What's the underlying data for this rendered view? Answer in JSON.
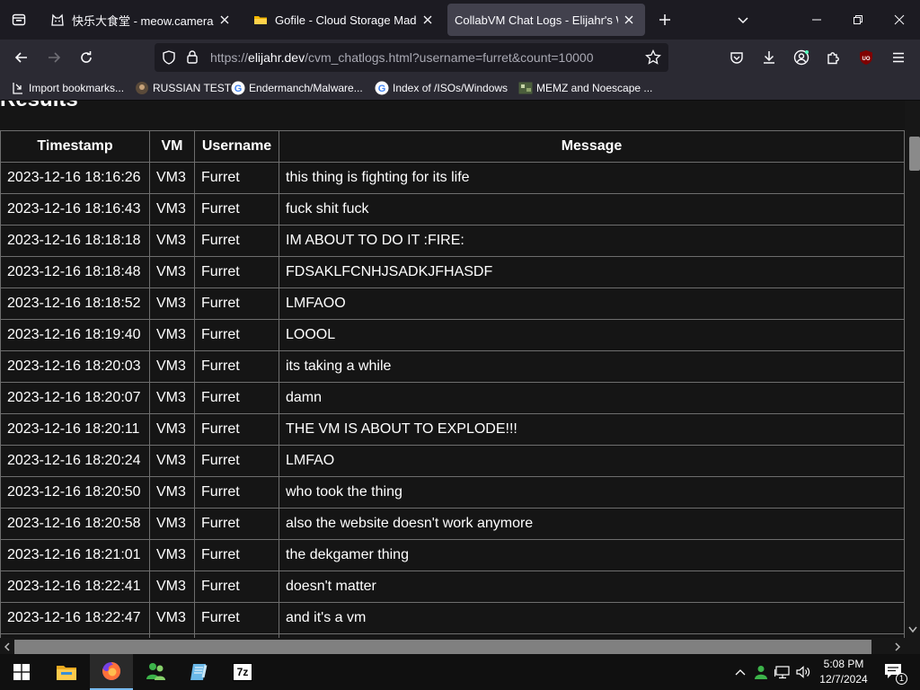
{
  "tabs": [
    {
      "title": "快乐大食堂 - meow.camera",
      "icon": "cat-favicon-icon"
    },
    {
      "title": "Gofile - Cloud Storage Made Simple",
      "icon": "gofile-favicon-icon"
    },
    {
      "title": "CollabVM Chat Logs - Elijahr's Website",
      "icon": "none"
    }
  ],
  "url": {
    "scheme": "https://",
    "host": "elijahr.dev",
    "path": "/cvm_chatlogs.html?username=furret&count=10000"
  },
  "bookmarks": [
    {
      "label": "Import bookmarks...",
      "icon": "import-icon"
    },
    {
      "label": "RUSSIAN TEST",
      "icon": "site-favicon-icon"
    },
    {
      "label": "Endermanch/Malware...",
      "icon": "google-icon"
    },
    {
      "label": "Index of /ISOs/Windows",
      "icon": "google-icon"
    },
    {
      "label": "MEMZ and Noescape ...",
      "icon": "image-favicon-icon"
    }
  ],
  "page": {
    "heading": "Results",
    "columns": [
      "Timestamp",
      "VM",
      "Username",
      "Message"
    ],
    "rows": [
      [
        "2023-12-16 18:16:26",
        "VM3",
        "Furret",
        "this thing is fighting for its life"
      ],
      [
        "2023-12-16 18:16:43",
        "VM3",
        "Furret",
        "fuck shit fuck"
      ],
      [
        "2023-12-16 18:18:18",
        "VM3",
        "Furret",
        "IM ABOUT TO DO IT :FIRE:"
      ],
      [
        "2023-12-16 18:18:48",
        "VM3",
        "Furret",
        "FDSAKLFCNHJSADKJFHASDF"
      ],
      [
        "2023-12-16 18:18:52",
        "VM3",
        "Furret",
        "LMFAOO"
      ],
      [
        "2023-12-16 18:19:40",
        "VM3",
        "Furret",
        "LOOOL"
      ],
      [
        "2023-12-16 18:20:03",
        "VM3",
        "Furret",
        "its taking a while"
      ],
      [
        "2023-12-16 18:20:07",
        "VM3",
        "Furret",
        "damn"
      ],
      [
        "2023-12-16 18:20:11",
        "VM3",
        "Furret",
        "THE VM IS ABOUT TO EXPLODE!!!"
      ],
      [
        "2023-12-16 18:20:24",
        "VM3",
        "Furret",
        "LMFAO"
      ],
      [
        "2023-12-16 18:20:50",
        "VM3",
        "Furret",
        "who took the thing"
      ],
      [
        "2023-12-16 18:20:58",
        "VM3",
        "Furret",
        "also the website doesn't work anymore"
      ],
      [
        "2023-12-16 18:21:01",
        "VM3",
        "Furret",
        "the dekgamer thing"
      ],
      [
        "2023-12-16 18:22:41",
        "VM3",
        "Furret",
        "doesn't matter"
      ],
      [
        "2023-12-16 18:22:47",
        "VM3",
        "Furret",
        "and it's a vm"
      ],
      [
        "",
        "",
        "",
        ""
      ]
    ]
  },
  "taskbar": {
    "apps": [
      "file-explorer-icon",
      "firefox-icon",
      "msn-messenger-icon",
      "notepad-icon",
      "7zip-icon"
    ],
    "zip_label": "7z",
    "time": "5:08 PM",
    "date": "12/7/2024",
    "notification_count": "1"
  },
  "colors": {
    "tabstrip": "#1c1b22",
    "toolbar": "#2b2a33",
    "page_bg": "#151515",
    "table_border": "#6e6e6e",
    "ublock_red": "#800000"
  }
}
